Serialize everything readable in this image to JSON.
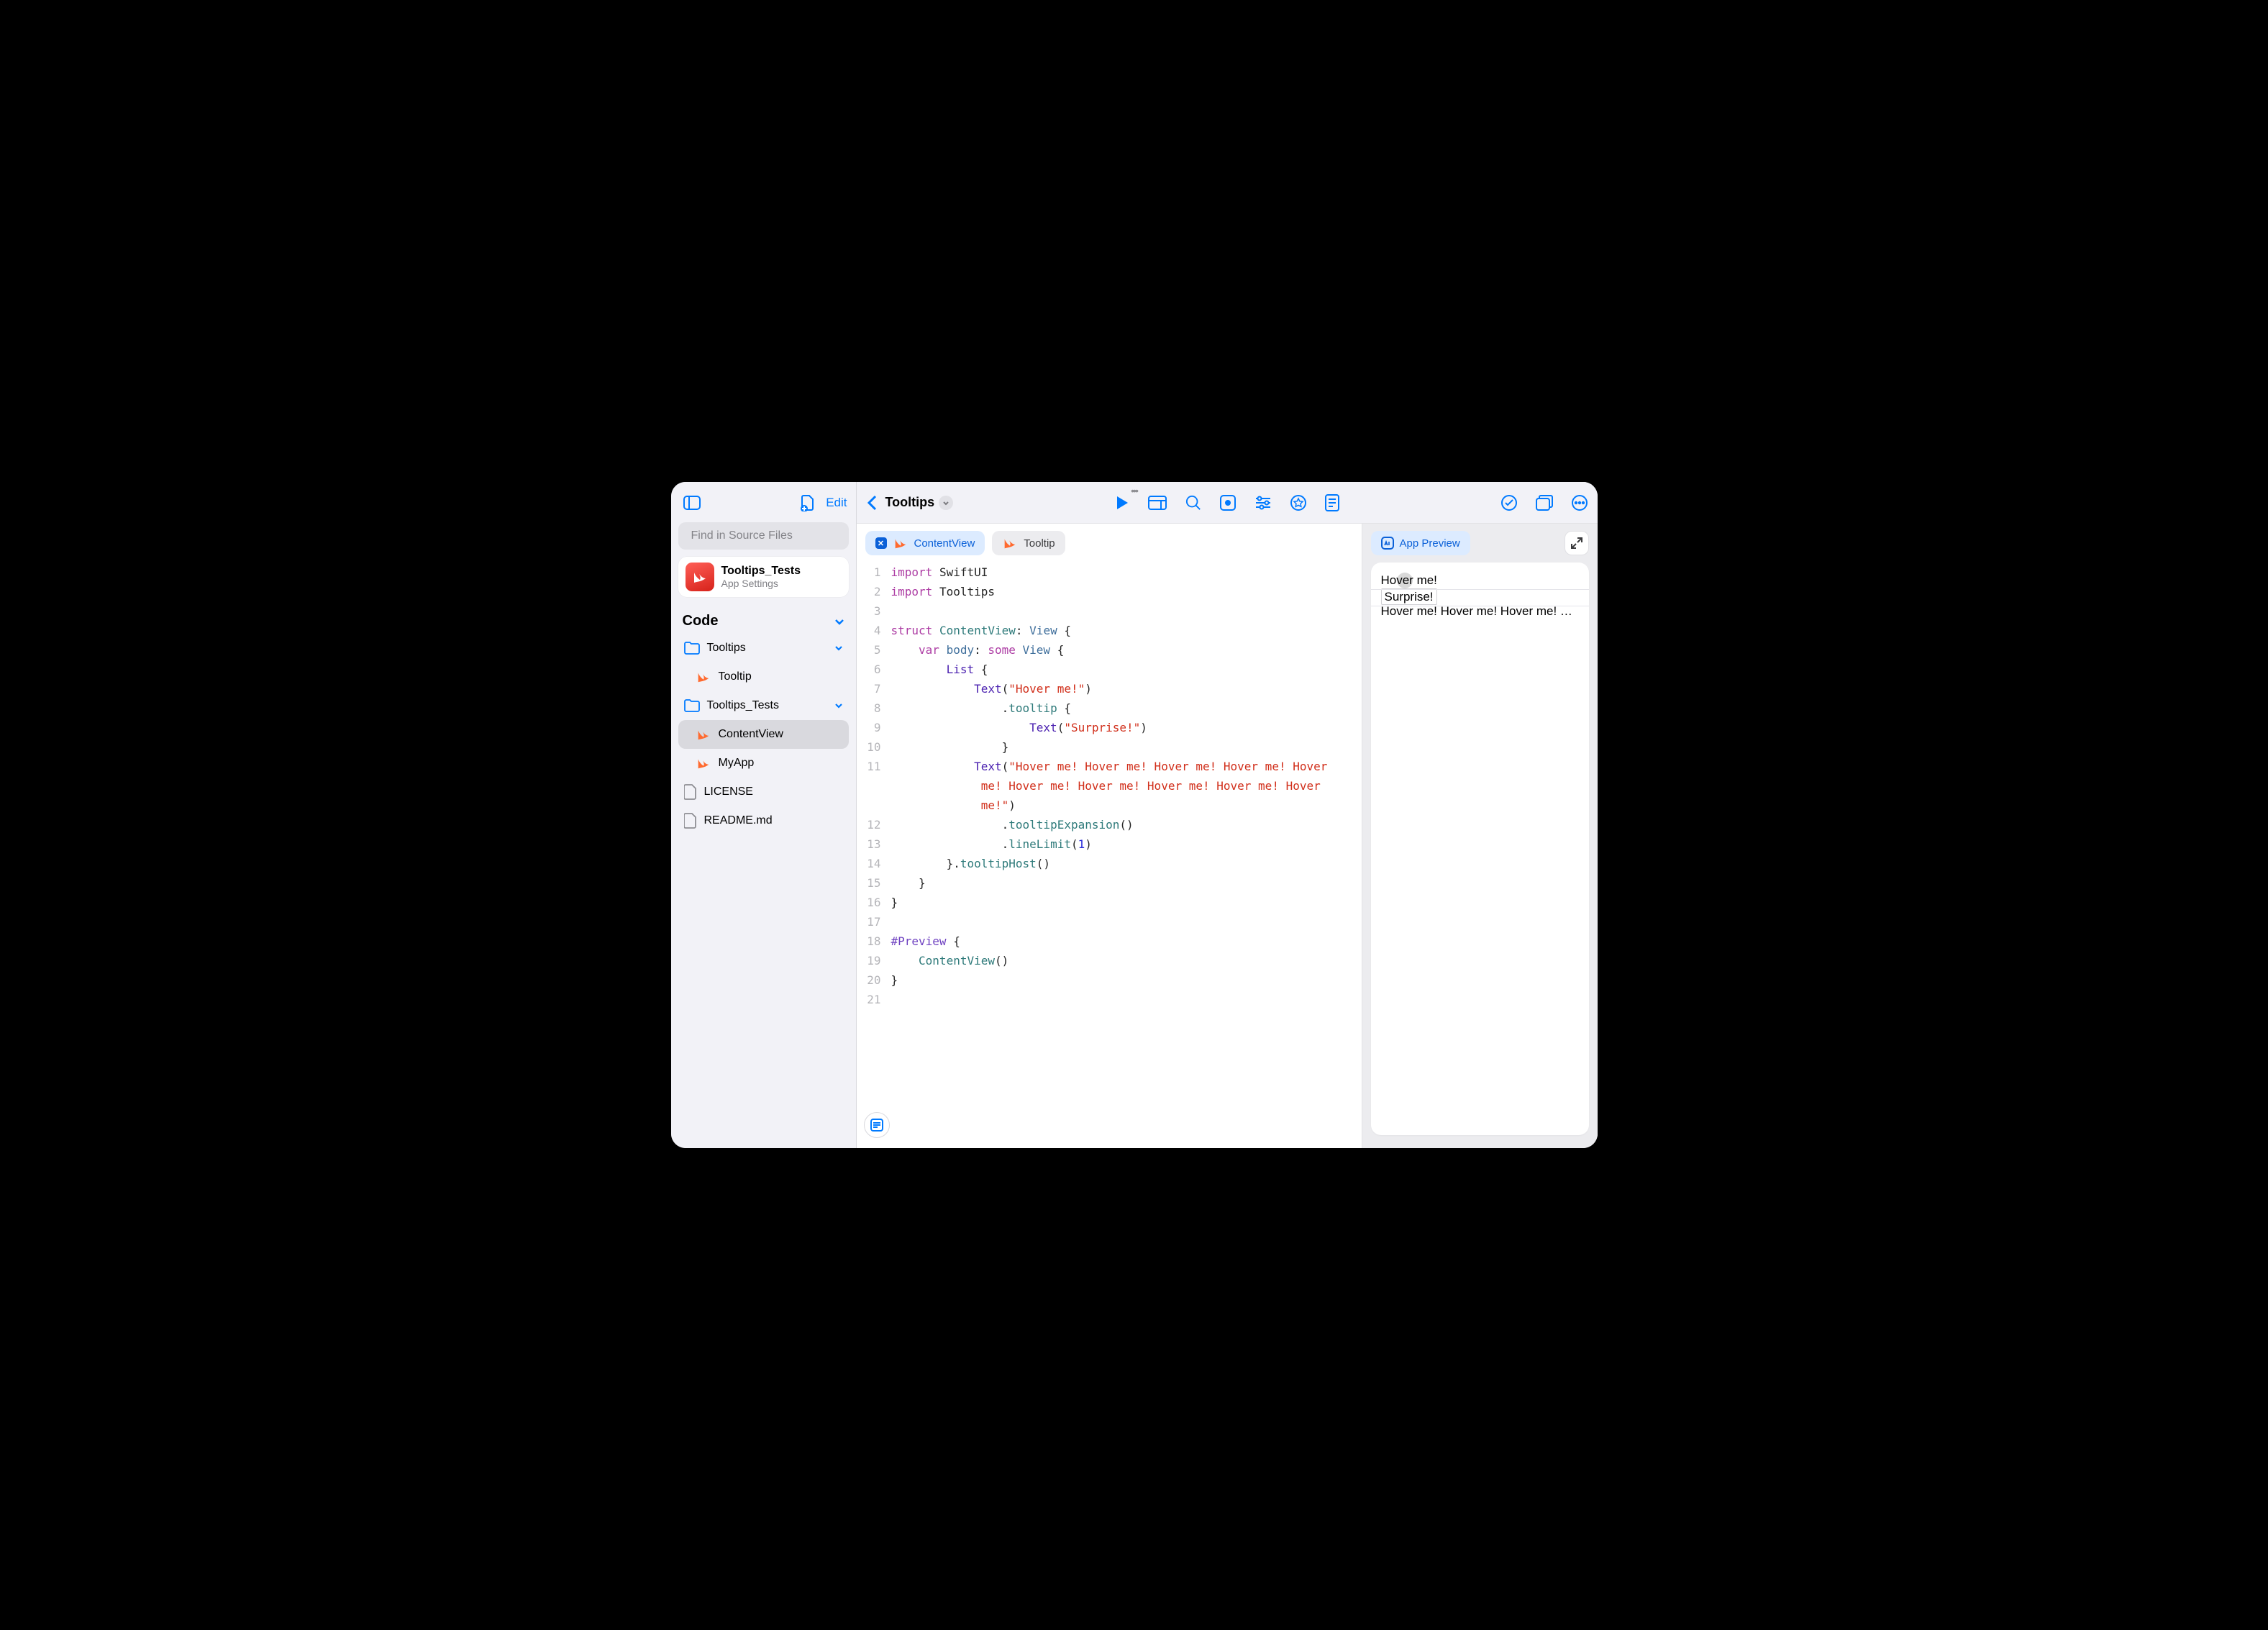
{
  "sidebar": {
    "edit_label": "Edit",
    "search_placeholder": "Find in Source Files",
    "app": {
      "title": "Tooltips_Tests",
      "subtitle": "App Settings"
    },
    "section_label": "Code",
    "items": [
      {
        "label": "Tooltips",
        "kind": "folder",
        "indent": 1,
        "expandable": true
      },
      {
        "label": "Tooltip",
        "kind": "swift",
        "indent": 2
      },
      {
        "label": "Tooltips_Tests",
        "kind": "folder",
        "indent": 1,
        "expandable": true
      },
      {
        "label": "ContentView",
        "kind": "swift",
        "indent": 2,
        "selected": true
      },
      {
        "label": "MyApp",
        "kind": "swift",
        "indent": 2
      },
      {
        "label": "LICENSE",
        "kind": "file",
        "indent": 1
      },
      {
        "label": "README.md",
        "kind": "file",
        "indent": 1
      }
    ]
  },
  "toolbar": {
    "breadcrumb_title": "Tooltips"
  },
  "tabs": [
    {
      "label": "ContentView",
      "active": true
    },
    {
      "label": "Tooltip",
      "active": false
    }
  ],
  "code": {
    "lines": [
      [
        {
          "t": "import ",
          "c": "k-keyword"
        },
        {
          "t": "SwiftUI"
        }
      ],
      [
        {
          "t": "import ",
          "c": "k-keyword"
        },
        {
          "t": "Tooltips"
        }
      ],
      [],
      [
        {
          "t": "struct ",
          "c": "k-keyword"
        },
        {
          "t": "ContentView",
          "c": "k-type"
        },
        {
          "t": ": "
        },
        {
          "t": "View",
          "c": "k-typelib"
        },
        {
          "t": " {"
        }
      ],
      [
        {
          "t": "    "
        },
        {
          "t": "var ",
          "c": "k-keyword"
        },
        {
          "t": "body",
          "c": "k-typelib"
        },
        {
          "t": ": "
        },
        {
          "t": "some ",
          "c": "k-keyword"
        },
        {
          "t": "View",
          "c": "k-typelib"
        },
        {
          "t": " {"
        }
      ],
      [
        {
          "t": "        "
        },
        {
          "t": "List",
          "c": "k-func"
        },
        {
          "t": " {"
        }
      ],
      [
        {
          "t": "            "
        },
        {
          "t": "Text",
          "c": "k-func"
        },
        {
          "t": "("
        },
        {
          "t": "\"Hover me!\"",
          "c": "k-string"
        },
        {
          "t": ")"
        }
      ],
      [
        {
          "t": "                ."
        },
        {
          "t": "tooltip",
          "c": "k-member"
        },
        {
          "t": " {"
        }
      ],
      [
        {
          "t": "                    "
        },
        {
          "t": "Text",
          "c": "k-func"
        },
        {
          "t": "("
        },
        {
          "t": "\"Surprise!\"",
          "c": "k-string"
        },
        {
          "t": ")"
        }
      ],
      [
        {
          "t": "                }"
        }
      ],
      [
        {
          "t": "            "
        },
        {
          "t": "Text",
          "c": "k-func"
        },
        {
          "t": "("
        },
        {
          "t": "\"Hover me! Hover me! Hover me! Hover me! Hover ",
          "c": "k-string"
        }
      ],
      [
        {
          "t": "             "
        },
        {
          "t": "me! Hover me! Hover me! Hover me! Hover me! Hover ",
          "c": "k-string"
        }
      ],
      [
        {
          "t": "             "
        },
        {
          "t": "me!\"",
          "c": "k-string"
        },
        {
          "t": ")"
        }
      ],
      [
        {
          "t": "                ."
        },
        {
          "t": "tooltipExpansion",
          "c": "k-member"
        },
        {
          "t": "()"
        }
      ],
      [
        {
          "t": "                ."
        },
        {
          "t": "lineLimit",
          "c": "k-member"
        },
        {
          "t": "("
        },
        {
          "t": "1",
          "c": "k-num"
        },
        {
          "t": ")"
        }
      ],
      [
        {
          "t": "        }."
        },
        {
          "t": "tooltipHost",
          "c": "k-member"
        },
        {
          "t": "()"
        }
      ],
      [
        {
          "t": "    }"
        }
      ],
      [
        {
          "t": "}"
        }
      ],
      [],
      [
        {
          "t": "#Preview",
          "c": "k-attr"
        },
        {
          "t": " {"
        }
      ],
      [
        {
          "t": "    "
        },
        {
          "t": "ContentView",
          "c": "k-type"
        },
        {
          "t": "()"
        }
      ],
      [
        {
          "t": "}"
        }
      ],
      []
    ],
    "gutter_numbers": [
      "1",
      "2",
      "3",
      "4",
      "5",
      "6",
      "7",
      "8",
      "9",
      "10",
      "11",
      "",
      "",
      "12",
      "13",
      "14",
      "15",
      "16",
      "17",
      "18",
      "19",
      "20",
      "21"
    ]
  },
  "preview": {
    "pill_label": "App Preview",
    "row1": "Hover me!",
    "tooltip": "Surprise!",
    "row2": "Hover me! Hover me! Hover me! Hover me! Hover me!"
  }
}
